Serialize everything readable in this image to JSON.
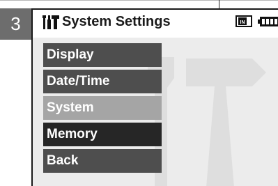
{
  "step_number": "3",
  "title": "System Settings",
  "icons": {
    "title": "settings-icon",
    "memory": "internal-memory-icon",
    "battery": "battery-icon",
    "memory_label": "IN"
  },
  "menu": {
    "items": [
      {
        "label": "Display",
        "state": "normal"
      },
      {
        "label": "Date/Time",
        "state": "normal"
      },
      {
        "label": "System",
        "state": "selected"
      },
      {
        "label": "Memory",
        "state": "highlight"
      },
      {
        "label": "Back",
        "state": "normal"
      }
    ]
  },
  "colors": {
    "menu_item": "#4e4e4e",
    "menu_selected": "#a5a5a5",
    "menu_highlight": "#262626",
    "badge": "#6d6d6d",
    "screen_bg": "#ececec"
  }
}
